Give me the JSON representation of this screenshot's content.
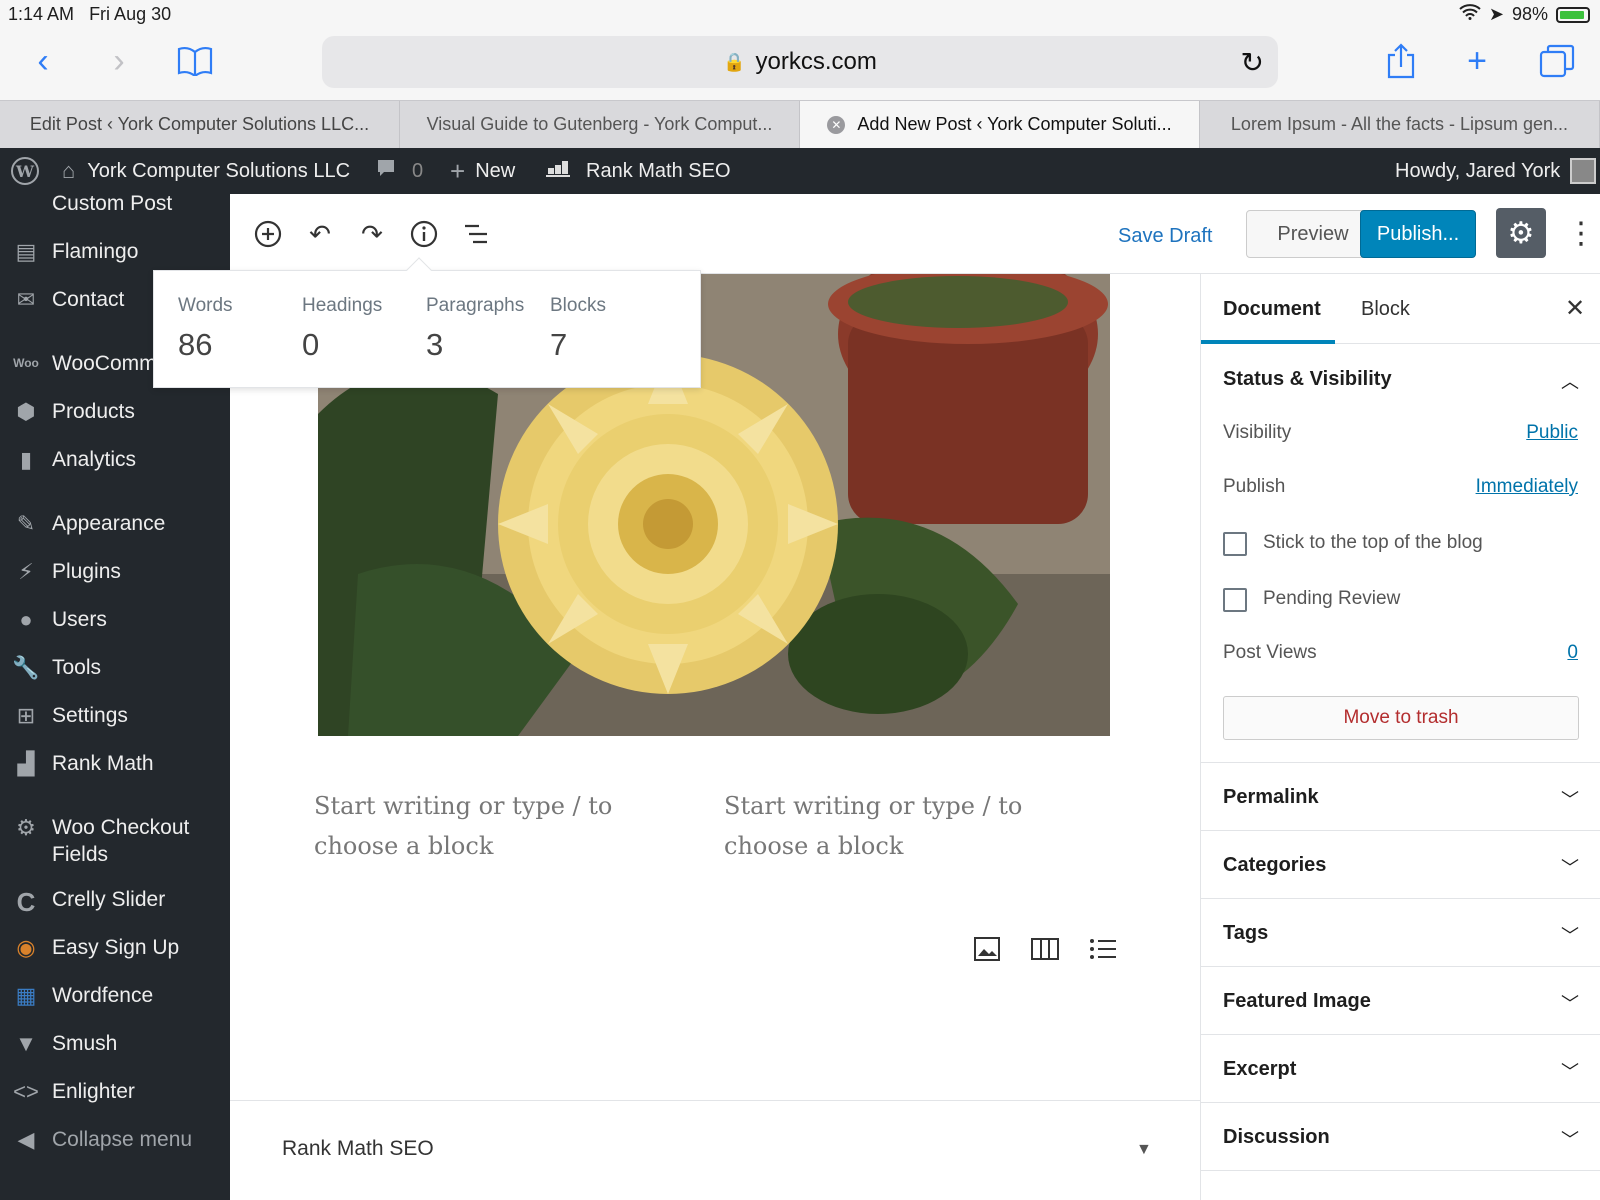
{
  "status_bar": {
    "time": "1:14 AM",
    "date": "Fri Aug 30",
    "battery": "98%"
  },
  "browser": {
    "url": "yorkcs.com",
    "tabs": [
      {
        "label": "Edit Post ‹ York Computer Solutions LLC..."
      },
      {
        "label": "Visual Guide to Gutenberg - York Comput..."
      },
      {
        "label": "Add New Post ‹ York Computer Soluti..."
      },
      {
        "label": "Lorem Ipsum - All the facts - Lipsum gen..."
      }
    ]
  },
  "admin_bar": {
    "site_name": "York Computer Solutions LLC",
    "comments_count": "0",
    "new_label": "New",
    "rank_math_label": "Rank Math SEO",
    "howdy": "Howdy, Jared York"
  },
  "sidebar": {
    "items": [
      {
        "label": "Custom Post",
        "icon": "custom-post-icon"
      },
      {
        "label": "Flamingo",
        "icon": "flamingo-icon"
      },
      {
        "label": "Contact",
        "icon": "mail-icon"
      },
      {
        "label": "WooComm",
        "icon": "woo-icon"
      },
      {
        "label": "Products",
        "icon": "box-icon"
      },
      {
        "label": "Analytics",
        "icon": "bar-chart-icon"
      },
      {
        "label": "Appearance",
        "icon": "brush-icon"
      },
      {
        "label": "Plugins",
        "icon": "plug-icon"
      },
      {
        "label": "Users",
        "icon": "user-icon"
      },
      {
        "label": "Tools",
        "icon": "wrench-icon"
      },
      {
        "label": "Settings",
        "icon": "sliders-icon"
      },
      {
        "label": "Rank Math",
        "icon": "rank-math-icon"
      },
      {
        "label": "Woo Checkout Fields",
        "icon": "gear-icon"
      },
      {
        "label": "Crelly Slider",
        "icon": "crelly-icon"
      },
      {
        "label": "Easy Sign Up",
        "icon": "signup-icon"
      },
      {
        "label": "Wordfence",
        "icon": "wordfence-icon"
      },
      {
        "label": "Smush",
        "icon": "smush-icon"
      },
      {
        "label": "Enlighter",
        "icon": "code-icon"
      },
      {
        "label": "Collapse menu",
        "icon": "collapse-icon"
      }
    ]
  },
  "toolbar": {
    "save_draft": "Save Draft",
    "preview": "Preview",
    "publish": "Publish..."
  },
  "info_popover": {
    "stats": [
      {
        "label": "Words",
        "value": "86"
      },
      {
        "label": "Headings",
        "value": "0"
      },
      {
        "label": "Paragraphs",
        "value": "3"
      },
      {
        "label": "Blocks",
        "value": "7"
      }
    ]
  },
  "editor": {
    "placeholder_left": "Start writing or type / to choose a block",
    "placeholder_right": "Start writing or type / to choose a block",
    "rank_math_panel": "Rank Math SEO"
  },
  "settings_sidebar": {
    "tab_document": "Document",
    "tab_block": "Block",
    "status_title": "Status & Visibility",
    "visibility_label": "Visibility",
    "visibility_value": "Public",
    "publish_label": "Publish",
    "publish_value": "Immediately",
    "stick_label": "Stick to the top of the blog",
    "pending_label": "Pending Review",
    "post_views_label": "Post Views",
    "post_views_value": "0",
    "trash_label": "Move to trash",
    "panels": [
      "Permalink",
      "Categories",
      "Tags",
      "Featured Image",
      "Excerpt",
      "Discussion"
    ]
  },
  "colors": {
    "admin_dark": "#23282d",
    "primary_blue": "#0085ba",
    "link_blue": "#0073aa",
    "trash_red": "#b32d2e"
  }
}
